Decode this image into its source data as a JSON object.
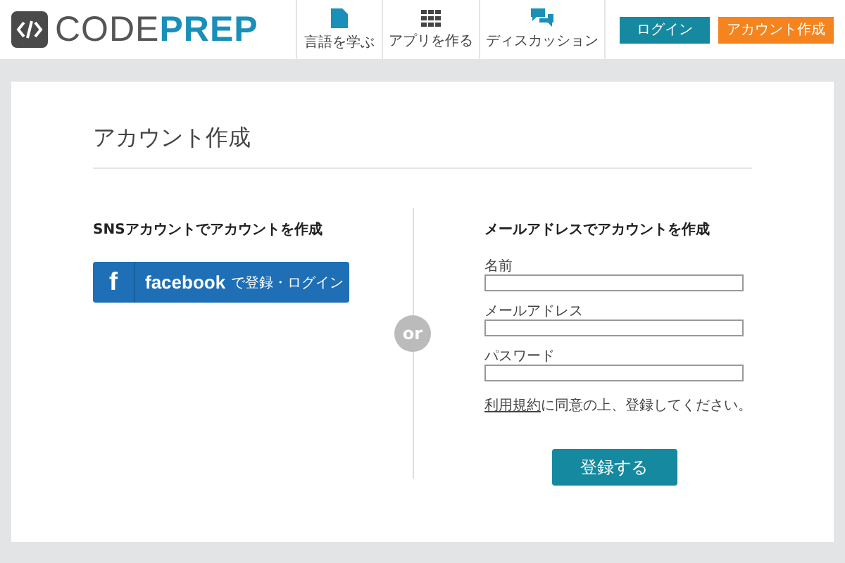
{
  "header": {
    "logo_text_a": "CODE",
    "logo_text_b": "PREP",
    "nav": [
      {
        "label": "言語を学ぶ",
        "kind": "doc"
      },
      {
        "label": "アプリを作る",
        "kind": "grid"
      },
      {
        "label": "ディスカッション",
        "kind": "chat"
      }
    ],
    "login_button": "ログイン",
    "signup_button": "アカウント作成"
  },
  "page_title": "アカウント作成",
  "sns": {
    "heading": "SNSアカウントでアカウントを作成",
    "button_icon": "f",
    "button_brand": "facebook",
    "button_text": "で登録・ログイン"
  },
  "divider_label": "or",
  "mail": {
    "heading": "メールアドレスでアカウントを作成",
    "fields": [
      {
        "label": "名前"
      },
      {
        "label": "メールアドレス"
      },
      {
        "label": "パスワード"
      }
    ],
    "terms_link": "利用規約",
    "terms_text": "に同意の上、登録してください。",
    "submit": "登録する"
  }
}
